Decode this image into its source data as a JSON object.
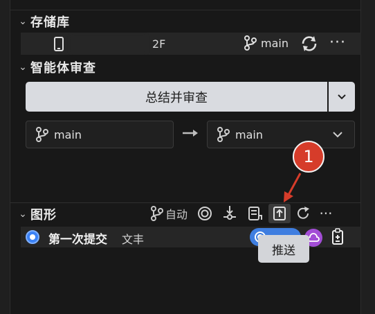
{
  "repositories": {
    "section_title": "存储库",
    "repo_name_visible": "2F",
    "branch": "main"
  },
  "agent_review": {
    "section_title": "智能体审查",
    "summarize_button": "总结并审查",
    "source_branch": "main",
    "target_branch": "main"
  },
  "graph": {
    "section_title": "图形",
    "auto_label": "自动",
    "commit": {
      "message": "第一次提交",
      "author": "文丰"
    },
    "tooltip": "推送"
  },
  "annotation": {
    "badge_number": "1",
    "color": "#d63c2a"
  },
  "colors": {
    "background": "#181818",
    "row_bg": "#262626",
    "accent_blue": "#3b82f6",
    "accent_purple": "#a34dd6",
    "button_bg": "#d9dbe0"
  }
}
